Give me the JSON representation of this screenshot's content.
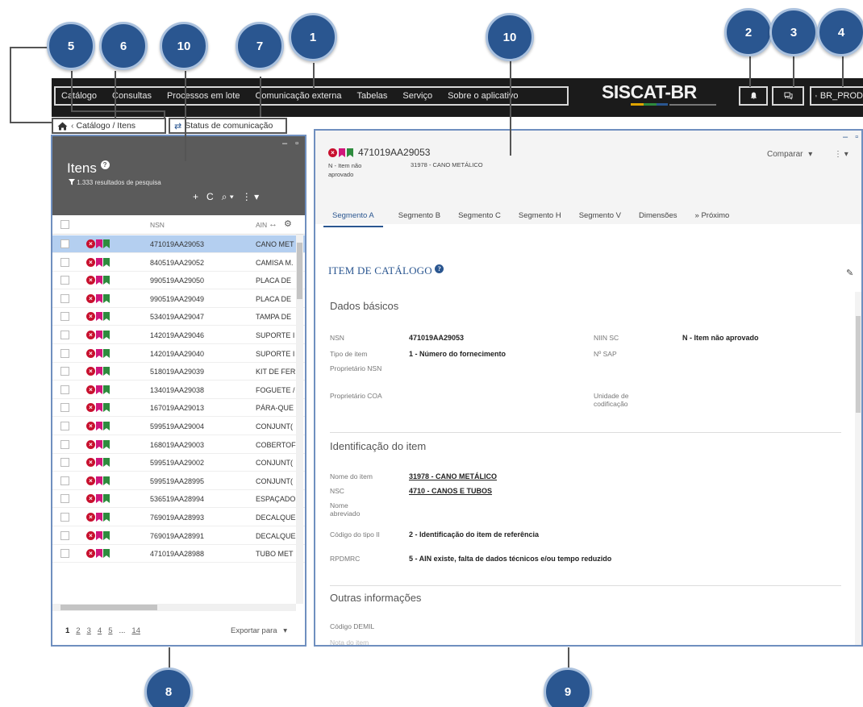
{
  "topnav": {
    "items": [
      "Catálogo",
      "Consultas",
      "Processos em lote",
      "Comunicação externa",
      "Tabelas",
      "Serviço",
      "Sobre o aplicativo"
    ],
    "logo": "SISCAT-BR",
    "bell_icon": "bell-icon",
    "chat_icon": "chat-icon",
    "user_icon": "user-icon",
    "user_label": "BR_PROD"
  },
  "breadcrumb": {
    "home_icon": "home-icon",
    "path": "Catálogo / Itens",
    "status_icon": "swap-arrows-icon",
    "status_label": "Status de comunicação"
  },
  "items_panel": {
    "title": "Itens",
    "results": "1.333 resultados de pesquisa",
    "columns": {
      "nsn": "NSN",
      "ain": "AIN"
    },
    "rows": [
      {
        "nsn": "471019AA29053",
        "ain": "CANO MET",
        "selected": true
      },
      {
        "nsn": "840519AA29052",
        "ain": "CAMISA M."
      },
      {
        "nsn": "990519AA29050",
        "ain": "PLACA DE"
      },
      {
        "nsn": "990519AA29049",
        "ain": "PLACA DE"
      },
      {
        "nsn": "534019AA29047",
        "ain": "TAMPA DE"
      },
      {
        "nsn": "142019AA29046",
        "ain": "SUPORTE I"
      },
      {
        "nsn": "142019AA29040",
        "ain": "SUPORTE I"
      },
      {
        "nsn": "518019AA29039",
        "ain": "KIT DE FER"
      },
      {
        "nsn": "134019AA29038",
        "ain": "FOGUETE /"
      },
      {
        "nsn": "167019AA29013",
        "ain": "PÁRA-QUE"
      },
      {
        "nsn": "599519AA29004",
        "ain": "CONJUNT("
      },
      {
        "nsn": "168019AA29003",
        "ain": "COBERTOF"
      },
      {
        "nsn": "599519AA29002",
        "ain": "CONJUNT("
      },
      {
        "nsn": "599519AA28995",
        "ain": "CONJUNT("
      },
      {
        "nsn": "536519AA28994",
        "ain": "ESPAÇADO"
      },
      {
        "nsn": "769019AA28993",
        "ain": "DECALQUE"
      },
      {
        "nsn": "769019AA28991",
        "ain": "DECALQUE"
      },
      {
        "nsn": "471019AA28988",
        "ain": "TUBO MET"
      }
    ],
    "pager": {
      "current": "1",
      "pages": [
        "2",
        "3",
        "4",
        "5"
      ],
      "ellipsis": "...",
      "last": "14"
    },
    "export_label": "Exportar para"
  },
  "detail": {
    "nsn_title": "471019AA29053",
    "status": "N - Item não aprovado",
    "name": "31978 - CANO METÁLICO",
    "compare_label": "Comparar",
    "tabs": [
      "Segmento A",
      "Segmento B",
      "Segmento C",
      "Segmento H",
      "Segmento V",
      "Dimensões",
      "» Próximo"
    ],
    "section_title": "ITEM DE CATÁLOGO",
    "basic": {
      "title": "Dados básicos",
      "nsn_label": "NSN",
      "nsn_value": "471019AA29053",
      "tipo_label": "Tipo de item",
      "tipo_value": "1 - Número do fornecimento",
      "prop_nsn_label": "Proprietário NSN",
      "prop_coa_label": "Proprietário COA",
      "niin_label": "NIIN SC",
      "niin_value": "N - Item não aprovado",
      "sap_label": "Nº SAP",
      "unidade_label": "Unidade de codificação"
    },
    "ident": {
      "title": "Identificação do item",
      "nome_label": "Nome do item",
      "nome_value": "31978 - CANO METÁLICO",
      "nsc_label": "NSC",
      "nsc_value": "4710 - CANOS E TUBOS",
      "abrev_label": "Nome abreviado",
      "codigo_label": "Código do tipo II",
      "codigo_value": "2 - Identificação do item de referência",
      "rpdmrc_label": "RPDMRC",
      "rpdmrc_value": "5 - AIN existe, falta de dados técnicos e/ou tempo reduzido"
    },
    "outras": {
      "title": "Outras informações",
      "demil_label": "Código DEMIL",
      "nota_label": "Nota do item"
    }
  },
  "callouts": [
    "5",
    "6",
    "10",
    "7",
    "1",
    "10",
    "2",
    "3",
    "4",
    "8",
    "9"
  ],
  "colors": {
    "callout_fill": "#2a5690",
    "topbar": "#1b1b1b",
    "selected_row": "#b4cff0",
    "status_red": "#c8102e",
    "bookmark_magenta": "#d0167a",
    "bookmark_green": "#2e8b3e"
  }
}
